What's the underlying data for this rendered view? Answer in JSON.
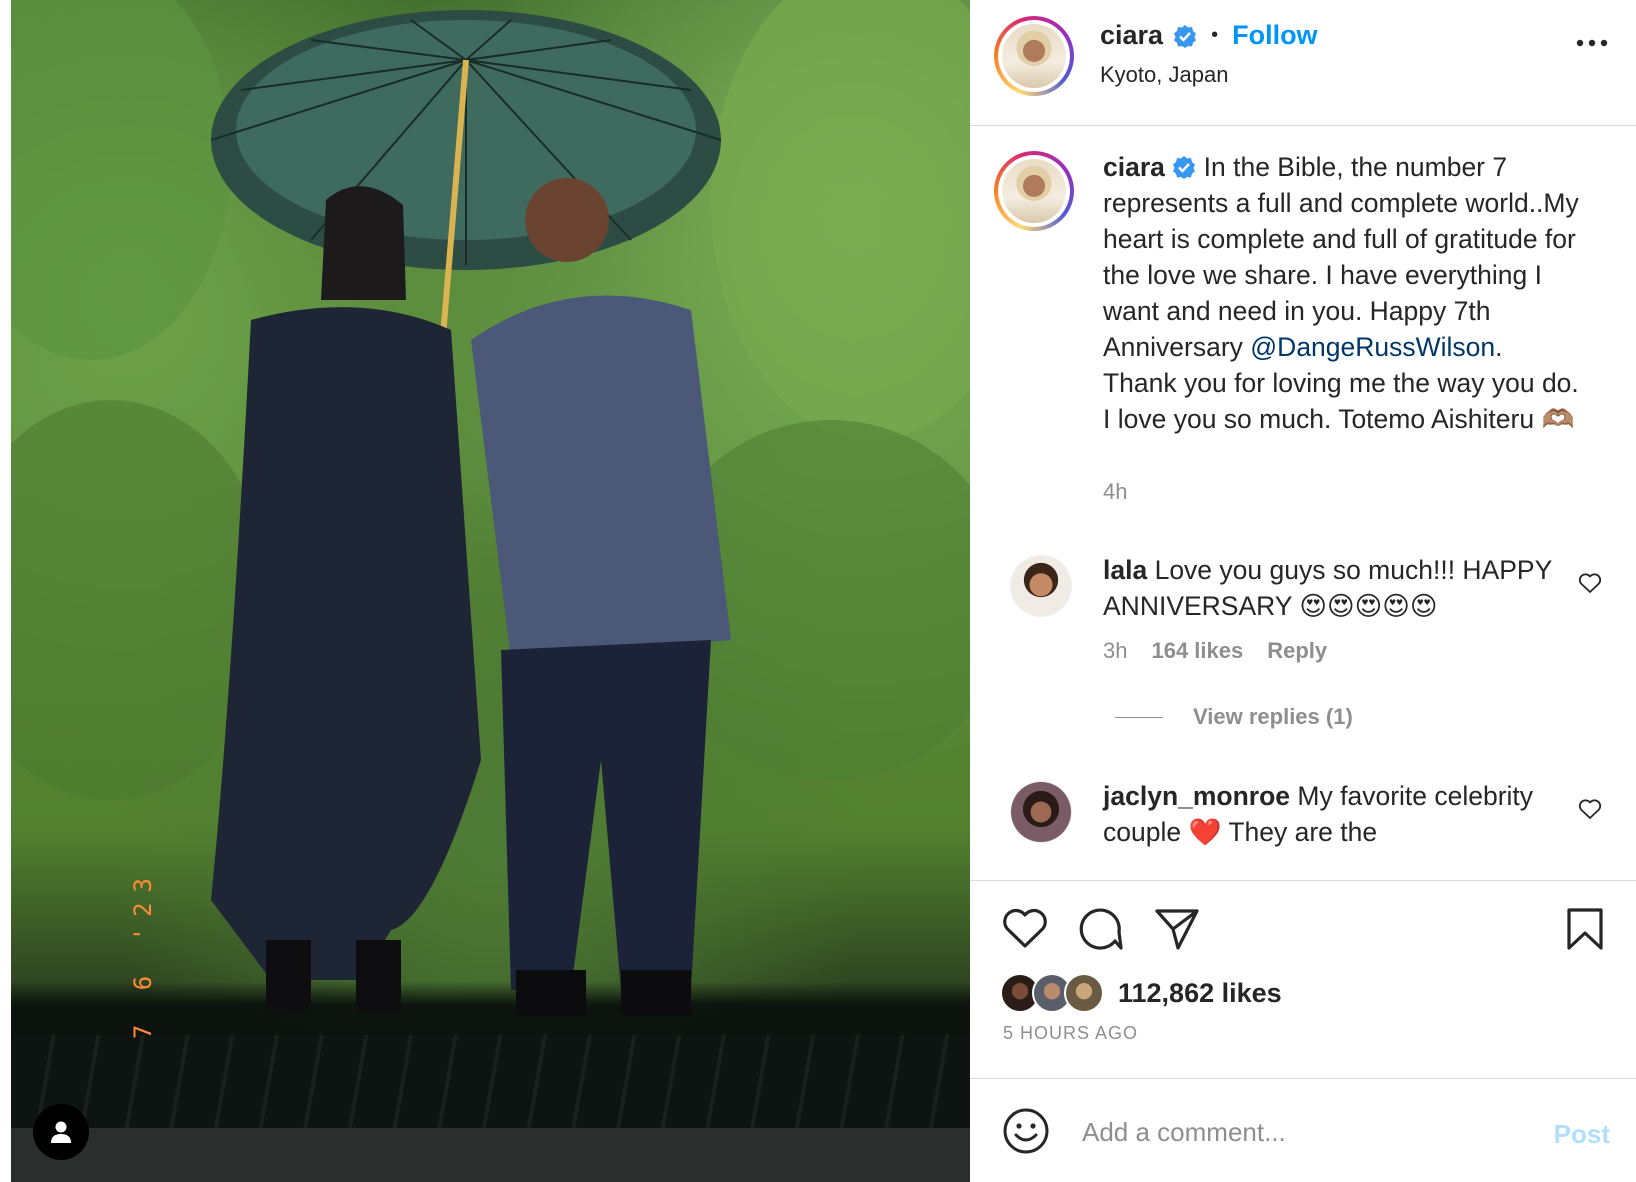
{
  "photo": {
    "date_stamp": "7 6 '23",
    "user_tag_icon": "person-icon"
  },
  "post": {
    "username": "ciara",
    "follow_label": "Follow",
    "separator": "•",
    "location": "Kyoto, Japan",
    "more_icon": "more-horizontal-icon"
  },
  "caption": {
    "username": "ciara",
    "text_before_mention": "In the Bible, the number 7 represents a full and complete world..My heart is complete and full of gratitude for the love we share. I have everything I want and need in you. Happy 7th Anniversary ",
    "mention": "@DangeRussWilson",
    "text_after_mention": ". Thank you for loving me the way you do. I love you so much. Totemo Aishiteru 🫶🏽",
    "time": "4h"
  },
  "comments": [
    {
      "username": "lala",
      "text": "Love you guys so much!!! HAPPY ANNIVERSARY 😍😍😍😍😍",
      "time": "3h",
      "likes": "164 likes",
      "reply_label": "Reply",
      "view_replies": "View replies (1)"
    },
    {
      "username": "jaclyn_monroe",
      "text": "My favorite celebrity couple ❤️ They are the"
    }
  ],
  "actions": {
    "likes_count": "112,862 likes",
    "time_ago": "5 HOURS AGO"
  },
  "comment_box": {
    "placeholder": "Add a comment...",
    "post_label": "Post"
  },
  "colors": {
    "accent": "#0095f6",
    "verified": "#3897f0",
    "mention": "#00376b",
    "muted": "#8e8e8e",
    "post_disabled": "#b2dffc"
  }
}
